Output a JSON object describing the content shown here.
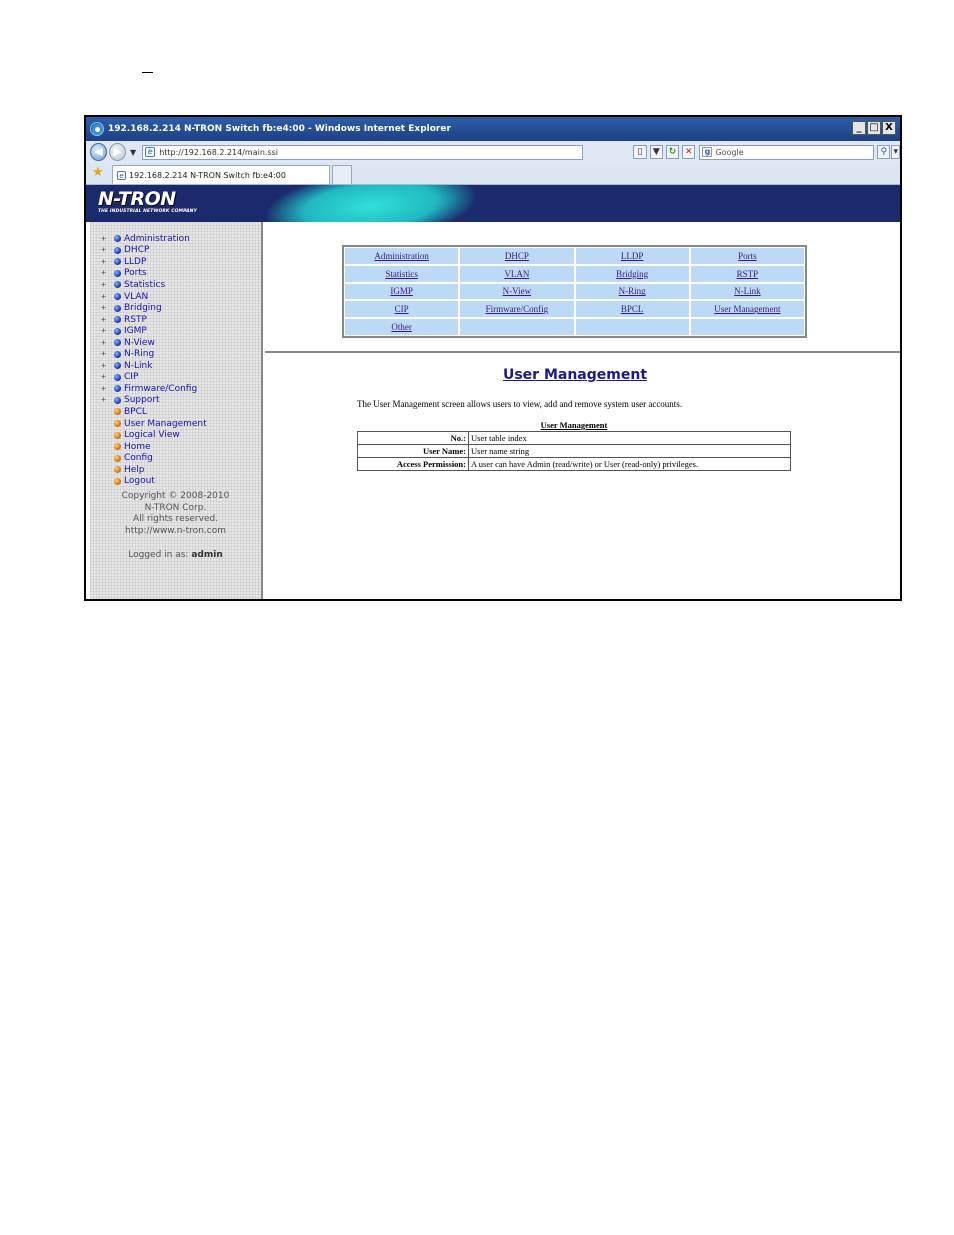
{
  "browser": {
    "title": "192.168.2.214 N-TRON Switch fb:e4:00 - Windows Internet Explorer",
    "window_buttons": [
      "_",
      "□",
      "X"
    ],
    "url": "http://192.168.2.214/main.ssi",
    "search_placeholder": "Google",
    "tab_title": "192.168.2.214 N-TRON Switch fb:e4:00"
  },
  "banner": {
    "logo": "N-TRON",
    "tagline": "THE INDUSTRIAL NETWORK COMPANY",
    "colors": {
      "background": "#1a2a6c",
      "accent": "#30e0d8"
    }
  },
  "sidebar": {
    "tree": [
      {
        "label": "Administration",
        "expandable": true,
        "icon": "blue-ball-icon"
      },
      {
        "label": "DHCP",
        "expandable": true,
        "icon": "blue-ball-icon"
      },
      {
        "label": "LLDP",
        "expandable": true,
        "icon": "blue-ball-icon"
      },
      {
        "label": "Ports",
        "expandable": true,
        "icon": "blue-ball-icon"
      },
      {
        "label": "Statistics",
        "expandable": true,
        "icon": "blue-ball-icon"
      },
      {
        "label": "VLAN",
        "expandable": true,
        "icon": "blue-ball-icon"
      },
      {
        "label": "Bridging",
        "expandable": true,
        "icon": "blue-ball-icon"
      },
      {
        "label": "RSTP",
        "expandable": true,
        "icon": "blue-ball-icon"
      },
      {
        "label": "IGMP",
        "expandable": true,
        "icon": "blue-ball-icon"
      },
      {
        "label": "N-View",
        "expandable": true,
        "icon": "blue-ball-icon"
      },
      {
        "label": "N-Ring",
        "expandable": true,
        "icon": "blue-ball-icon"
      },
      {
        "label": "N-Link",
        "expandable": true,
        "icon": "blue-ball-icon"
      },
      {
        "label": "CIP",
        "expandable": true,
        "icon": "blue-ball-icon"
      },
      {
        "label": "Firmware/Config",
        "expandable": true,
        "icon": "blue-ball-icon"
      },
      {
        "label": "Support",
        "expandable": true,
        "icon": "blue-ball-icon"
      },
      {
        "label": "BPCL",
        "expandable": false,
        "icon": "orange-ball-icon"
      },
      {
        "label": "User Management",
        "expandable": false,
        "icon": "orange-ball-icon"
      },
      {
        "label": "Logical View",
        "expandable": false,
        "icon": "orange-ball-icon"
      },
      {
        "label": "Home",
        "expandable": false,
        "icon": "orange-ball-icon"
      },
      {
        "label": "Config",
        "expandable": false,
        "icon": "orange-ball-icon"
      },
      {
        "label": "Help",
        "expandable": false,
        "icon": "orange-ball-icon"
      },
      {
        "label": "Logout",
        "expandable": false,
        "icon": "orange-ball-icon"
      }
    ],
    "copyright": [
      "Copyright © 2008-2010",
      "N-TRON Corp.",
      "All rights reserved.",
      "http://www.n-tron.com"
    ],
    "logged_in_label": "Logged in as:",
    "logged_in_user": "admin"
  },
  "nav_links": [
    "Administration",
    "DHCP",
    "LLDP",
    "Ports",
    "Statistics",
    "VLAN",
    "Bridging",
    "RSTP",
    "IGMP",
    "N-View",
    "N-Ring",
    "N-Link",
    "CIP",
    "Firmware/Config",
    "BPCL",
    "User Management",
    "Other",
    "",
    "",
    ""
  ],
  "main": {
    "title": "User Management",
    "description": "The User Management screen allows users to view, add and remove system user accounts.",
    "table_caption": "User Management",
    "rows": [
      {
        "key": "No.:",
        "value": "User table index"
      },
      {
        "key": "User Name:",
        "value": "User name string"
      },
      {
        "key": "Access Permission:",
        "value": "A user can have Admin (read/write) or User (read-only) privileges."
      }
    ]
  }
}
